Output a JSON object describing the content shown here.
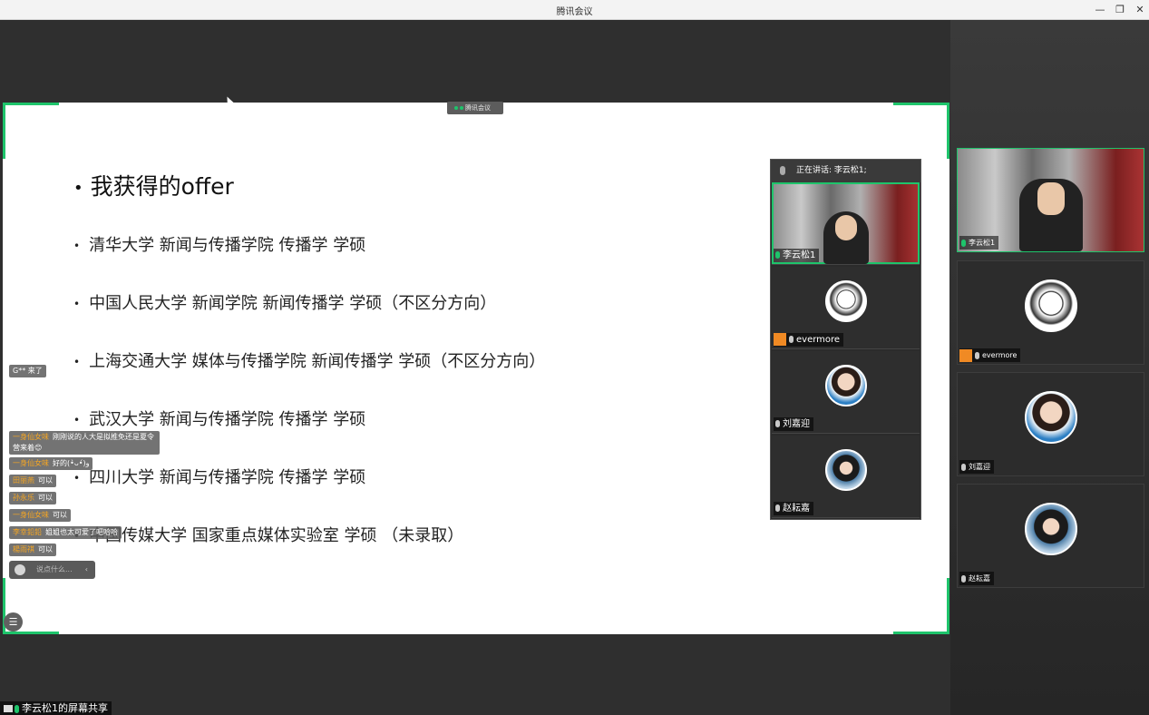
{
  "window": {
    "title": "腾讯会议"
  },
  "share_tag": "腾讯会议",
  "slide": {
    "heading": "我获得的offer",
    "items": [
      "清华大学  新闻与传播学院  传播学  学硕",
      "中国人民大学  新闻学院  新闻传播学  学硕（不区分方向）",
      "上海交通大学  媒体与传播学院  新闻传播学  学硕（不区分方向）",
      "武汉大学  新闻与传播学院  传播学  学硕",
      "四川大学  新闻与传播学院  传播学  学硕",
      "中国传媒大学  国家重点媒体实验室  学硕  （未录取）"
    ]
  },
  "floating_video": {
    "speaking": "正在讲话: 李云松1;",
    "participants": [
      {
        "name": "李云松1",
        "kind": "camera"
      },
      {
        "name": "evermore",
        "kind": "anime"
      },
      {
        "name": "刘嘉迎",
        "kind": "girl"
      },
      {
        "name": "赵耘嘉",
        "kind": "girl2"
      }
    ]
  },
  "side_video": {
    "participants": [
      {
        "name": "李云松1"
      },
      {
        "name": "evermore"
      },
      {
        "name": "刘嘉迎"
      },
      {
        "name": "赵耘嘉"
      }
    ]
  },
  "chat": {
    "join_notice": "G** 来了",
    "messages": [
      {
        "user": "一身仙女味",
        "text": "刚刚说的人大是拟推免还是夏令营来着😊"
      },
      {
        "user": "一身仙女味",
        "text": "好的(•̀ᴗ•́)و"
      },
      {
        "user": "田丽燕",
        "text": "可以"
      },
      {
        "user": "孙永乐",
        "text": "可以"
      },
      {
        "user": "一身仙女味",
        "text": "可以"
      },
      {
        "user": "李幸鉛鉛",
        "text": "姐姐也太可爱了吧哈哈"
      },
      {
        "user": "楊雨祺",
        "text": "可以"
      }
    ],
    "input_placeholder": "说点什么..."
  },
  "bottom_label": "李云松1的屏幕共享"
}
